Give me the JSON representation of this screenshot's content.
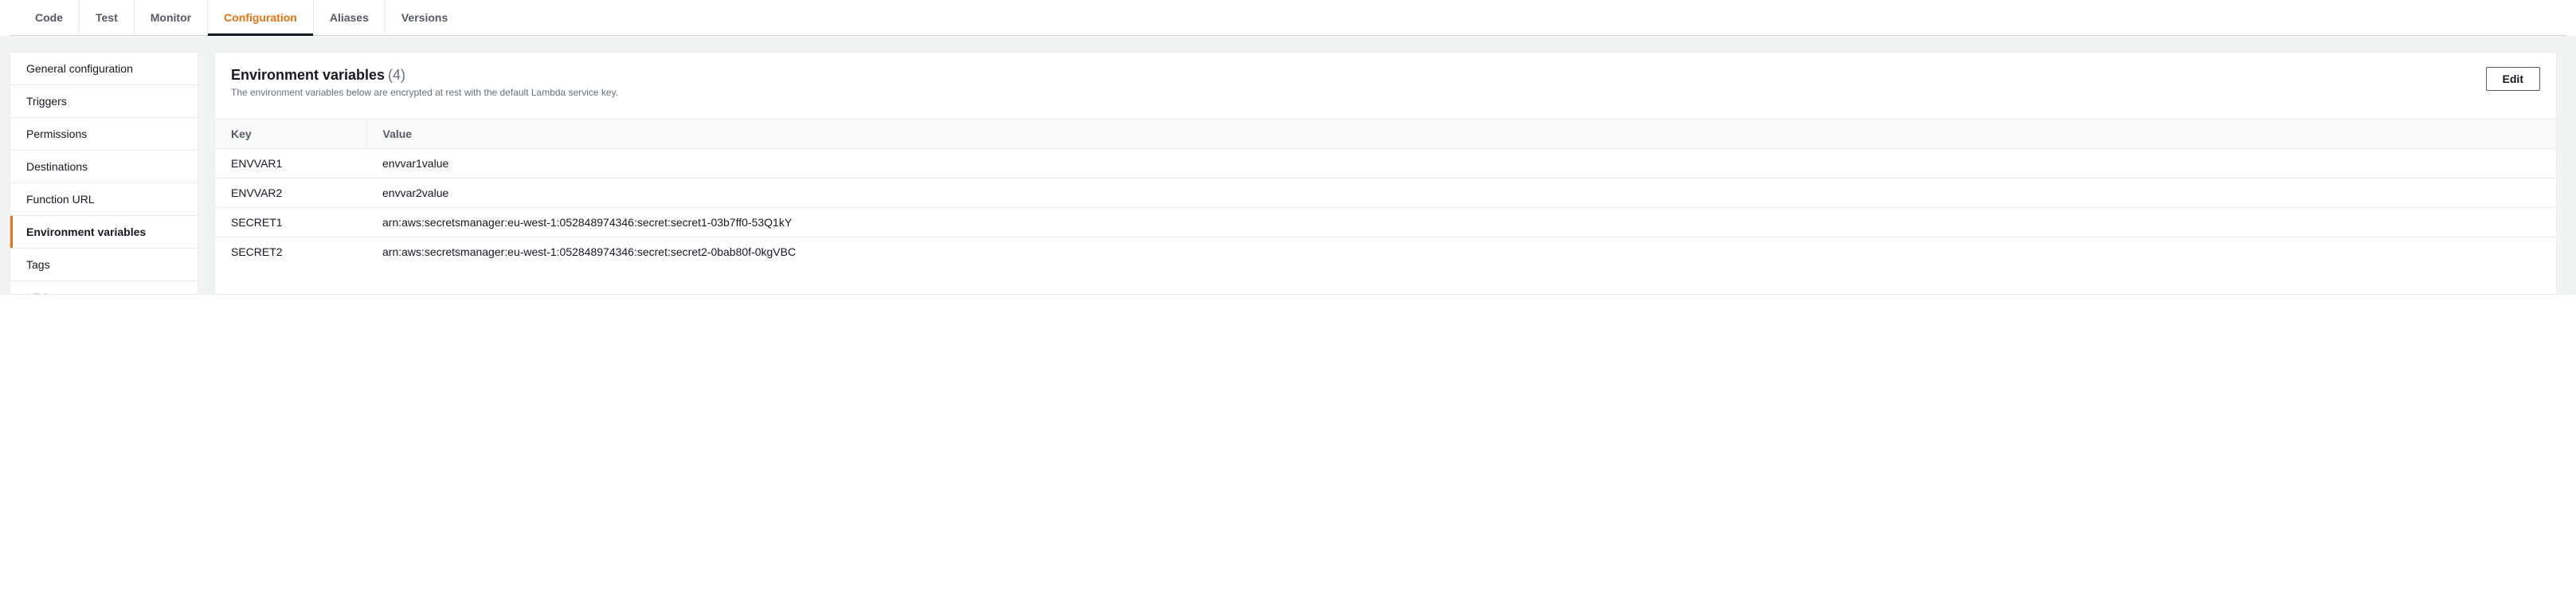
{
  "tabs": [
    {
      "label": "Code",
      "active": false
    },
    {
      "label": "Test",
      "active": false
    },
    {
      "label": "Monitor",
      "active": false
    },
    {
      "label": "Configuration",
      "active": true
    },
    {
      "label": "Aliases",
      "active": false
    },
    {
      "label": "Versions",
      "active": false
    }
  ],
  "sidebar": {
    "items": [
      {
        "label": "General configuration",
        "active": false
      },
      {
        "label": "Triggers",
        "active": false
      },
      {
        "label": "Permissions",
        "active": false
      },
      {
        "label": "Destinations",
        "active": false
      },
      {
        "label": "Function URL",
        "active": false
      },
      {
        "label": "Environment variables",
        "active": true
      },
      {
        "label": "Tags",
        "active": false
      },
      {
        "label": "VPC",
        "active": false
      }
    ]
  },
  "panel": {
    "title": "Environment variables",
    "count": "(4)",
    "subtitle": "The environment variables below are encrypted at rest with the default Lambda service key.",
    "edit_label": "Edit"
  },
  "table": {
    "headers": {
      "key": "Key",
      "value": "Value"
    },
    "rows": [
      {
        "key": "ENVVAR1",
        "value": "envvar1value"
      },
      {
        "key": "ENVVAR2",
        "value": "envvar2value"
      },
      {
        "key": "SECRET1",
        "value": "arn:aws:secretsmanager:eu-west-1:052848974346:secret:secret1-03b7ff0-53Q1kY"
      },
      {
        "key": "SECRET2",
        "value": "arn:aws:secretsmanager:eu-west-1:052848974346:secret:secret2-0bab80f-0kgVBC"
      }
    ]
  }
}
